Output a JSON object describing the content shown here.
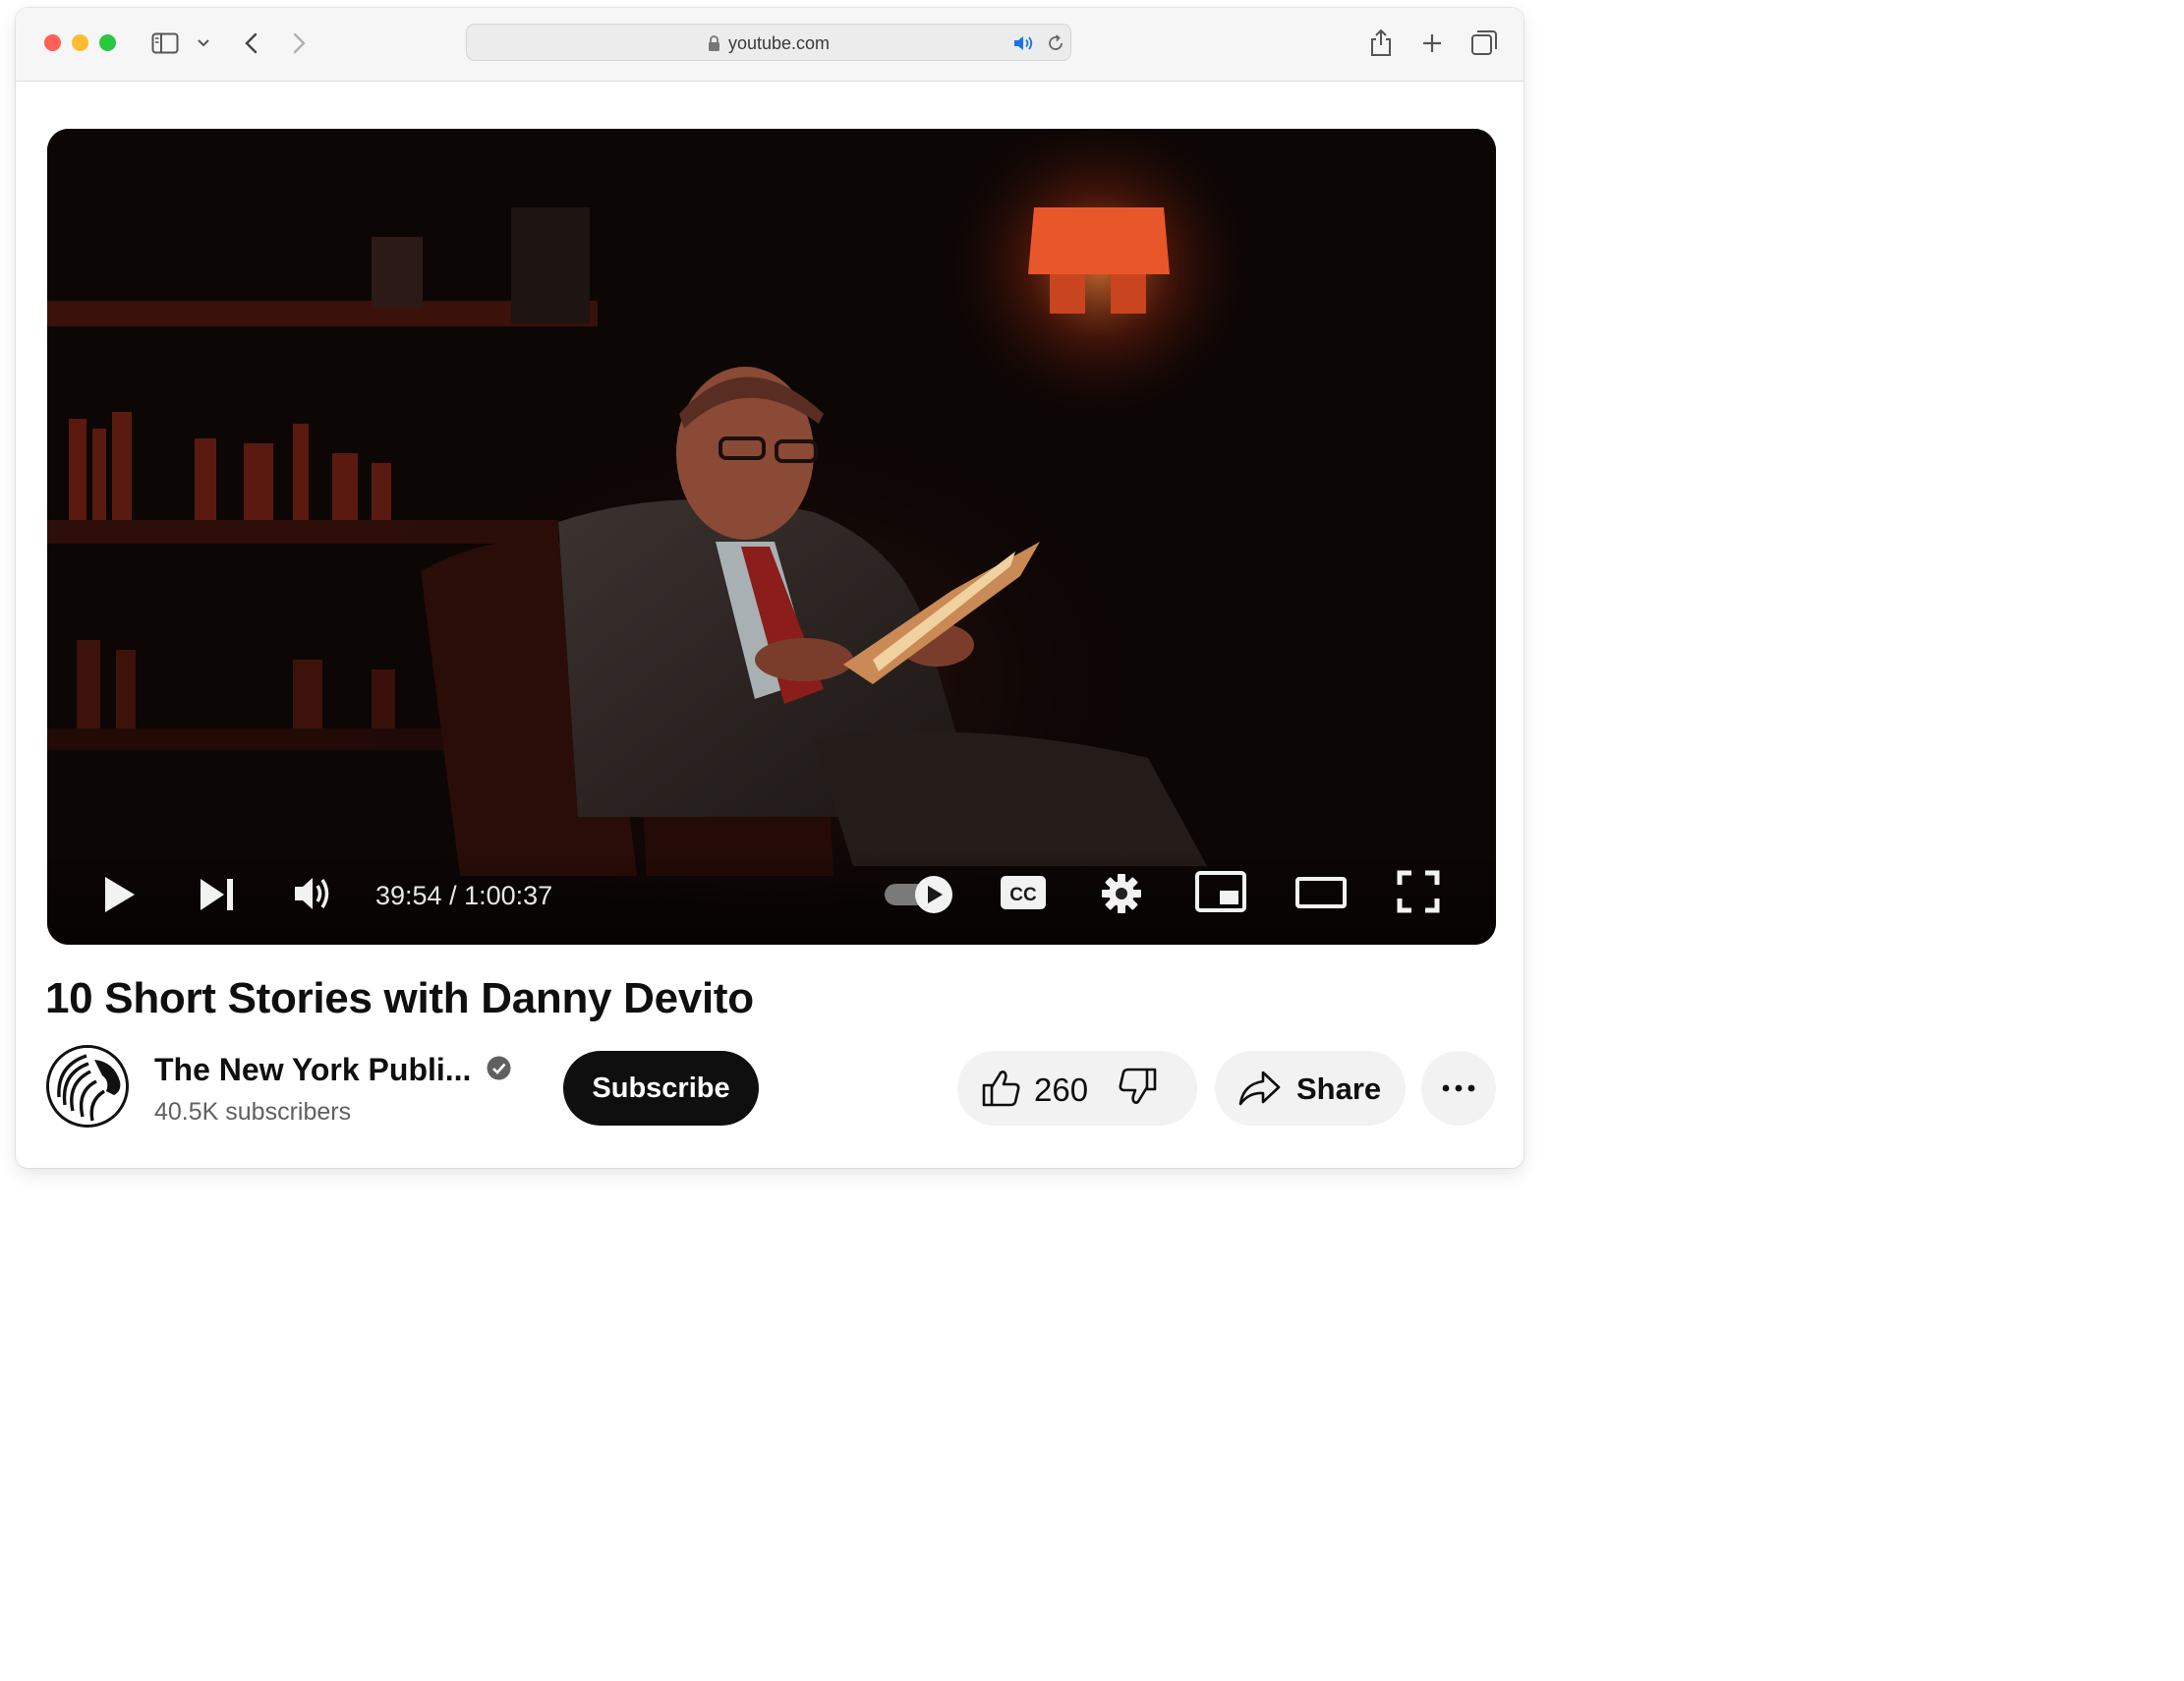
{
  "browser": {
    "url": "youtube.com"
  },
  "player": {
    "current_time": "39:54",
    "duration": "1:00:37",
    "time_display": "39:54 / 1:00:37",
    "cc_label": "CC",
    "autoplay_on": true
  },
  "video": {
    "title": "10 Short Stories with Danny Devito"
  },
  "channel": {
    "name": "The New York Publi...",
    "subscribers": "40.5K subscribers",
    "verified": true
  },
  "actions": {
    "subscribe_label": "Subscribe",
    "like_count": "260",
    "share_label": "Share"
  },
  "colors": {
    "close": "#ff5f57",
    "minimize": "#febc2e",
    "zoom": "#28c840",
    "audio_accent": "#1a73e8"
  }
}
